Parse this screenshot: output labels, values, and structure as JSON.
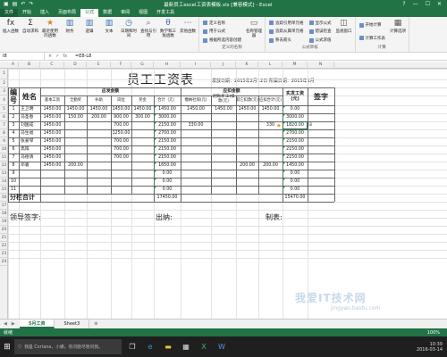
{
  "window": {
    "title": "最新员工excel工资表模板.xls [兼容模式] - Excel",
    "controls": [
      "?",
      "—",
      "☐",
      "✕"
    ]
  },
  "ribbon_tabs": [
    "文件",
    "开始",
    "插入",
    "页面布局",
    "公式",
    "数据",
    "审阅",
    "视图",
    "开发工具"
  ],
  "active_tab_index": 4,
  "ribbon": {
    "groups": [
      {
        "name": "",
        "buttons": [
          {
            "label": "插入函数",
            "icon": "fx-icon"
          },
          {
            "label": "自动求和",
            "icon": "sum-icon"
          },
          {
            "label": "最近使用的函数",
            "icon": "star-icon"
          },
          {
            "label": "财务",
            "icon": "book-icon"
          },
          {
            "label": "逻辑",
            "icon": "book-icon"
          },
          {
            "label": "文本",
            "icon": "book-icon"
          },
          {
            "label": "日期和时间",
            "icon": "clock-icon"
          },
          {
            "label": "查找与引用",
            "icon": "search-icon"
          },
          {
            "label": "数学和三角函数",
            "icon": "theta-icon"
          },
          {
            "label": "其他函数",
            "icon": "more-icon"
          }
        ]
      },
      {
        "name": "定义的名称",
        "small": [
          "定义名称",
          "用于公式",
          "根据所选内容创建"
        ],
        "big": {
          "label": "名称管理器",
          "icon": "tag-icon"
        }
      },
      {
        "name": "公式审核",
        "small": [
          "追踪引用单元格",
          "追踪从属单元格",
          "移去箭头",
          "显示公式",
          "错误检查",
          "公式求值"
        ],
        "big": {
          "label": "监视窗口",
          "icon": "watch-icon"
        }
      },
      {
        "name": "计算",
        "big": {
          "label": "计算选项",
          "icon": "calc-icon"
        },
        "small": [
          "开始计算",
          "计算工作表"
        ]
      }
    ]
  },
  "formula_bar": {
    "name_box": "I8",
    "icons": [
      "×",
      "✓",
      "fx"
    ],
    "formula": "=E8-L8"
  },
  "columns": [
    "A",
    "B",
    "C",
    "D",
    "E",
    "F",
    "G",
    "H",
    "I",
    "J",
    "K",
    "L",
    "M",
    "N"
  ],
  "rows": [
    "1",
    "2",
    "3",
    "4",
    "5",
    "6",
    "7",
    "8",
    "9",
    "10",
    "11",
    "12",
    "13",
    "14",
    "15",
    "16",
    "17",
    "18",
    "19",
    "20",
    "21",
    "22",
    "23",
    "24"
  ],
  "sheet": {
    "title": "员工工资表",
    "dates": "发放日期：2015年2月12日 所属日期：2015年1月",
    "headers": {
      "num": "编号",
      "name": "姓名",
      "group_pay": "应发金额",
      "group_deduct": "应扣金额",
      "base": "基本工资",
      "bonus": "全勤奖",
      "allowance": "补助",
      "position": "岗位",
      "reward": "奖金",
      "total": "合计（元）",
      "social": "缴纳社保(元)",
      "attendance": "迟到(旷工)扣款(元)",
      "other": "其它扣款(元)",
      "deduct_total": "应扣合计(元)",
      "net": "实发工资(元)",
      "sign": "签字"
    },
    "data_rows": [
      {
        "num": "1",
        "name": "王卫明",
        "base": "1450.00",
        "bonus": "1450.00",
        "allowance": "1450.00",
        "position": "1450.00",
        "reward": "1450.00",
        "total": "1450.00",
        "social": "1450.00",
        "attendance": "1450.00",
        "other": "1450.00",
        "deduct": "1450.00",
        "net": "0.00"
      },
      {
        "num": "2",
        "name": "马圣春",
        "base": "1450.00",
        "bonus": "150.00",
        "allowance": "200.00",
        "position": "900.00",
        "reward": "300.00",
        "total": "3000.00",
        "social": "",
        "attendance": "",
        "other": "",
        "deduct": "",
        "net": "3000.00"
      },
      {
        "num": "3",
        "name": "刘国成",
        "base": "1450.00",
        "bonus": "",
        "allowance": "",
        "position": "700.00",
        "reward": "",
        "total": "2150.00",
        "social": "330.00",
        "attendance": "",
        "other": "",
        "deduct": "330",
        "net": "1820.00"
      },
      {
        "num": "4",
        "name": "马生福",
        "base": "1450.00",
        "bonus": "",
        "allowance": "",
        "position": "1250.00",
        "reward": "",
        "total": "2700.00",
        "social": "",
        "attendance": "",
        "other": "",
        "deduct": "",
        "net": "2700.00"
      },
      {
        "num": "5",
        "name": "张爱琴",
        "base": "1450.00",
        "bonus": "",
        "allowance": "",
        "position": "700.00",
        "reward": "",
        "total": "2150.00",
        "social": "",
        "attendance": "",
        "other": "",
        "deduct": "",
        "net": "2150.00"
      },
      {
        "num": "6",
        "name": "高阳",
        "base": "1450.00",
        "bonus": "",
        "allowance": "",
        "position": "700.00",
        "reward": "",
        "total": "2150.00",
        "social": "",
        "attendance": "",
        "other": "",
        "deduct": "",
        "net": "2150.00"
      },
      {
        "num": "7",
        "name": "马德清",
        "base": "1450.00",
        "bonus": "",
        "allowance": "",
        "position": "700.00",
        "reward": "",
        "total": "2150.00",
        "social": "",
        "attendance": "",
        "other": "",
        "deduct": "",
        "net": "2150.00"
      },
      {
        "num": "8",
        "name": "邓睿",
        "base": "1450.00",
        "bonus": "200.00",
        "allowance": "",
        "position": "",
        "reward": "",
        "total": "1650.00",
        "social": "",
        "attendance": "",
        "other": "200.00",
        "deduct": "200.00",
        "net": "1450.00"
      },
      {
        "num": "9",
        "name": "",
        "base": "",
        "bonus": "",
        "allowance": "",
        "position": "",
        "reward": "",
        "total": "0.00",
        "social": "",
        "attendance": "",
        "other": "",
        "deduct": "",
        "net": "0.00"
      },
      {
        "num": "10",
        "name": "",
        "base": "",
        "bonus": "",
        "allowance": "",
        "position": "",
        "reward": "",
        "total": "0.00",
        "social": "",
        "attendance": "",
        "other": "",
        "deduct": "",
        "net": "0.00"
      },
      {
        "num": "11",
        "name": "",
        "base": "",
        "bonus": "",
        "allowance": "",
        "position": "",
        "reward": "",
        "total": "0.00",
        "social": "",
        "attendance": "",
        "other": "",
        "deduct": "",
        "net": "0.00"
      }
    ],
    "subtotal_label": "分栏合计",
    "subtotal_total": "17450.00",
    "subtotal_net": "15470.00",
    "footer": {
      "leader": "领导签字:",
      "cashier": "出纳:",
      "maker": "制表:"
    }
  },
  "sheet_tabs": [
    "5月工资",
    "Sheet3"
  ],
  "active_sheet_index": 0,
  "status": {
    "ready": "就绪",
    "zoom": "100%"
  },
  "taskbar": {
    "search_placeholder": "我是 Cortana，小娜。有问题尽管问我。",
    "time": "10:39",
    "date": "2016-03-14"
  },
  "watermark": {
    "brand": "我爱IT技术网",
    "site": "jingyan.baidu.com"
  },
  "colors": {
    "excel_green": "#217346",
    "selection": "#217346"
  }
}
